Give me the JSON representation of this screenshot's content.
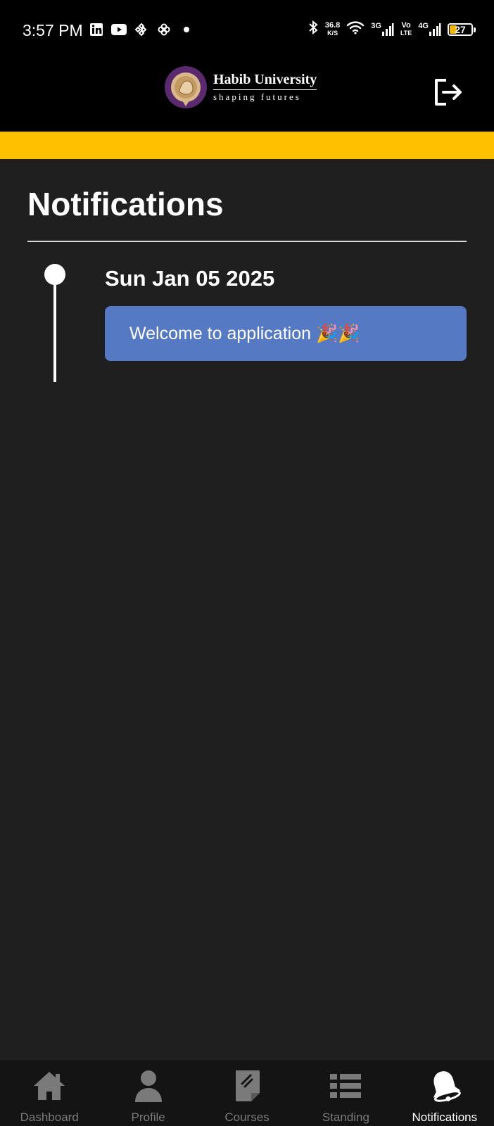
{
  "status_bar": {
    "time": "3:57 PM",
    "app_icons": [
      "linkedin-icon",
      "youtube-icon",
      "binance-icon",
      "fan-icon",
      "dot-icon"
    ],
    "speed_value": "36.8",
    "speed_unit": "K/S",
    "network_1": "3G",
    "volte_top": "Vo",
    "volte_bottom": "LTE",
    "network_2": "4G",
    "battery": "27"
  },
  "header": {
    "logo_name": "Habib University",
    "logo_tagline": "shaping futures",
    "seal_text": "HABIB UNIVERSITY"
  },
  "colors": {
    "accent": "#ffc000",
    "card": "#5579c2",
    "background": "#1f1f1f"
  },
  "page": {
    "title": "Notifications"
  },
  "notifications": [
    {
      "date": "Sun Jan 05 2025",
      "message": "Welcome to application 🎉🎉"
    }
  ],
  "bottom_nav": {
    "items": [
      {
        "label": "Dashboard",
        "icon": "home-icon"
      },
      {
        "label": "Profile",
        "icon": "person-icon"
      },
      {
        "label": "Courses",
        "icon": "document-icon"
      },
      {
        "label": "Standing",
        "icon": "list-icon"
      },
      {
        "label": "Notifications",
        "icon": "bell-icon",
        "active": true
      }
    ]
  }
}
